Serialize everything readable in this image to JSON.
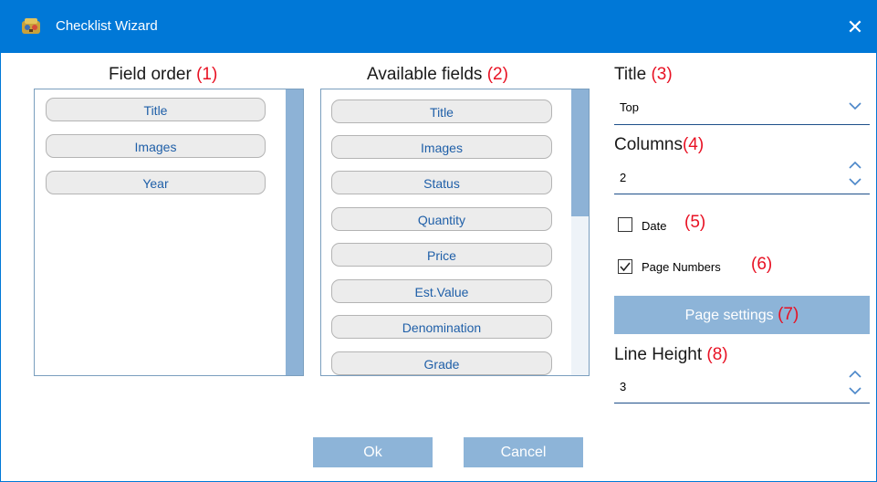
{
  "window": {
    "title": "Checklist Wizard",
    "close_glyph": "✕"
  },
  "field_order": {
    "label": "Field order",
    "number": "(1)",
    "items": [
      "Title",
      "Images",
      "Year"
    ]
  },
  "available_fields": {
    "label": "Available fields",
    "number": "(2)",
    "items": [
      "Title",
      "Images",
      "Status",
      "Quantity",
      "Price",
      "Est.Value",
      "Denomination",
      "Grade"
    ]
  },
  "title_setting": {
    "label": "Title",
    "number": "(3)",
    "value": "Top"
  },
  "columns_setting": {
    "label": "Columns",
    "number": "(4)",
    "value": "2"
  },
  "date_option": {
    "label": "Date",
    "number": "(5)",
    "checked": false
  },
  "page_numbers_option": {
    "label": "Page Numbers",
    "number": "(6)",
    "checked": true
  },
  "page_settings_button": {
    "label": "Page settings",
    "number": "(7)"
  },
  "line_height_setting": {
    "label": "Line Height",
    "number": "(8)",
    "value": "3"
  },
  "footer": {
    "ok_label": "Ok",
    "cancel_label": "Cancel"
  },
  "colors": {
    "accent": "#0078d7",
    "annotation": "#e81123",
    "button": "#8db4d8",
    "pill_text": "#1f5fa8"
  }
}
